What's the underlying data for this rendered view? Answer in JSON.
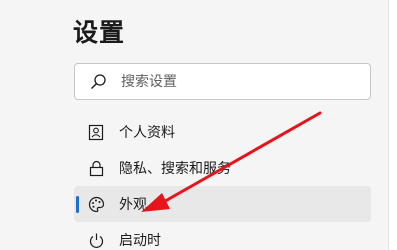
{
  "title": "设置",
  "search": {
    "placeholder": "搜索设置"
  },
  "nav": {
    "items": [
      {
        "label": "个人资料",
        "icon": "profile-icon"
      },
      {
        "label": "隐私、搜索和服务",
        "icon": "lock-icon"
      },
      {
        "label": "外观",
        "icon": "palette-icon",
        "selected": true
      },
      {
        "label": "启动时",
        "icon": "power-icon"
      }
    ]
  },
  "colors": {
    "accent": "#1a6fc8",
    "annotation_arrow": "#e8141b",
    "selected_bg": "#e8e8e8"
  }
}
